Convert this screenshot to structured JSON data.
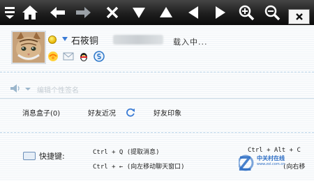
{
  "toolbar": {
    "buttons": [
      "menu-icon",
      "home-icon",
      "back-icon",
      "forward-icon",
      "close-page-icon",
      "page-down-icon",
      "page-up-icon",
      "prev-icon",
      "next-icon",
      "zoom-in-icon",
      "zoom-out-icon"
    ],
    "close_label": "×"
  },
  "profile": {
    "nickname": "石筱铜",
    "loading": "载入中..."
  },
  "signature": {
    "placeholder": "编辑个性签名"
  },
  "tabs": [
    {
      "label": "消息盒子(0)"
    },
    {
      "label": "好友近况"
    },
    {
      "label": "好友印象"
    }
  ],
  "shortcuts": {
    "label": "快捷键:",
    "items": [
      "Ctrl + Q (提取消息)",
      "Ctrl + ← (向左移动聊天窗口)",
      "Ctrl + Alt + C",
      "(向右移"
    ]
  },
  "watermark": {
    "text": "中关村在线",
    "url": "www.zol.com.cn"
  },
  "colors": {
    "toolbar_bg": "#1e1e1e",
    "accent": "#3a7bd5",
    "divider": "#bcd6ea"
  }
}
